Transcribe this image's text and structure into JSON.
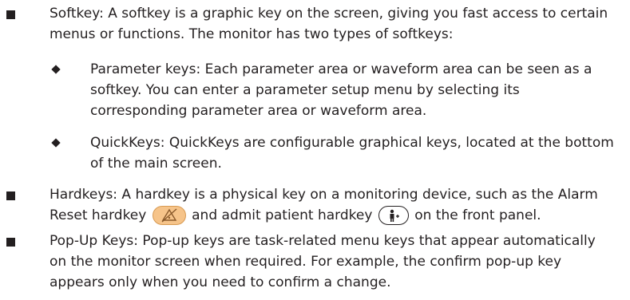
{
  "softkey": {
    "line1": "Softkey: A softkey is a graphic key on the screen, giving you fast access to certain",
    "line2": "menus or functions. The monitor has two types of softkeys:"
  },
  "parameter_keys": {
    "line1": "Parameter keys: Each parameter area or waveform area can be seen as a",
    "line2": "softkey. You can enter a parameter setup menu by selecting its",
    "line3": "corresponding parameter area or waveform area."
  },
  "quickkeys": {
    "line1": "QuickKeys: QuickKeys are configurable graphical keys, located at the bottom",
    "line2": "of the main screen."
  },
  "hardkeys": {
    "line1": "Hardkeys: A hardkey is a physical key on a monitoring device, such as the Alarm",
    "line2_a": "Reset hardkey",
    "line2_b": "and admit patient hardkey",
    "line2_c": "on the front panel."
  },
  "popup_keys": {
    "line1": "Pop-Up Keys: Pop-up keys are task-related menu keys that appear automatically",
    "line2": "on the monitor screen when required. For example, the confirm pop-up key",
    "line3": "appears only when you need to confirm a change."
  },
  "icons": {
    "alarm_reset": "alarm-reset-icon",
    "admit_patient": "admit-patient-icon"
  },
  "colors": {
    "text": "#231f20",
    "alarm_key_fill": "#f6c48a"
  }
}
